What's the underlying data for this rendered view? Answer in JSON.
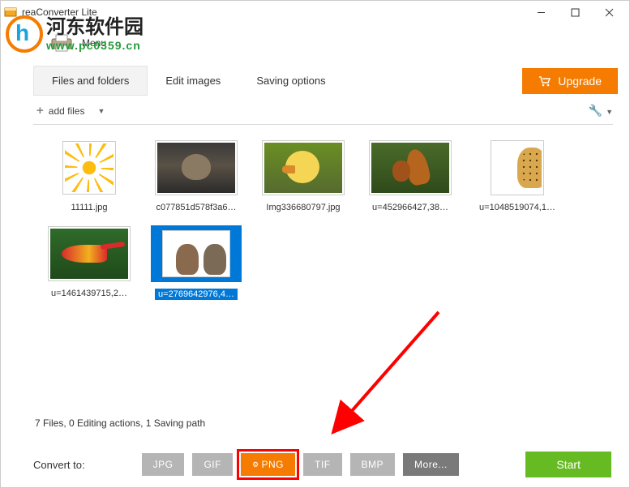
{
  "window": {
    "title": "reaConverter Lite"
  },
  "watermark": {
    "text": "河东软件园",
    "url": "www.pc0359.cn"
  },
  "menu": {
    "label": "Menu"
  },
  "tabs": {
    "files": "Files and folders",
    "edit": "Edit images",
    "saving": "Saving options"
  },
  "upgrade": {
    "label": "Upgrade"
  },
  "toolbar": {
    "add_files": "add files"
  },
  "items": [
    {
      "name": "11111.jpg"
    },
    {
      "name": "c077851d578f3a6…"
    },
    {
      "name": "Img336680797.jpg"
    },
    {
      "name": "u=452966427,38…"
    },
    {
      "name": "u=1048519074,1…"
    },
    {
      "name": "u=1461439715,2…"
    },
    {
      "name": "u=2769642976,4…"
    }
  ],
  "status": "7 Files, 0 Editing actions, 1 Saving path",
  "footer": {
    "convert_label": "Convert to:",
    "formats": {
      "jpg": "JPG",
      "gif": "GIF",
      "png": "PNG",
      "tif": "TIF",
      "bmp": "BMP",
      "more": "More..."
    },
    "start": "Start"
  }
}
